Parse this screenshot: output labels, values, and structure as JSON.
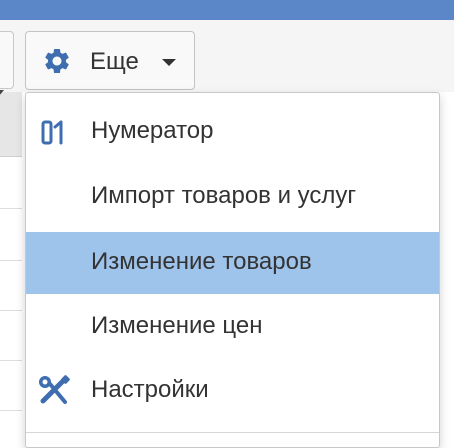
{
  "toolbar": {
    "more_label": "Еще",
    "more_icon": "gear-icon",
    "accent_color": "#3f6eb0"
  },
  "menu": {
    "items": [
      {
        "label": "Нумератор",
        "icon": "numerator-icon",
        "active": false
      },
      {
        "label": "Импорт товаров и услуг",
        "icon": null,
        "active": false
      },
      {
        "label": "Изменение товаров",
        "icon": null,
        "active": true
      },
      {
        "label": "Изменение цен",
        "icon": null,
        "active": false
      },
      {
        "label": "Настройки",
        "icon": "wrench-screwdriver-icon",
        "active": false
      }
    ],
    "highlight_color": "#9fc4ec"
  }
}
